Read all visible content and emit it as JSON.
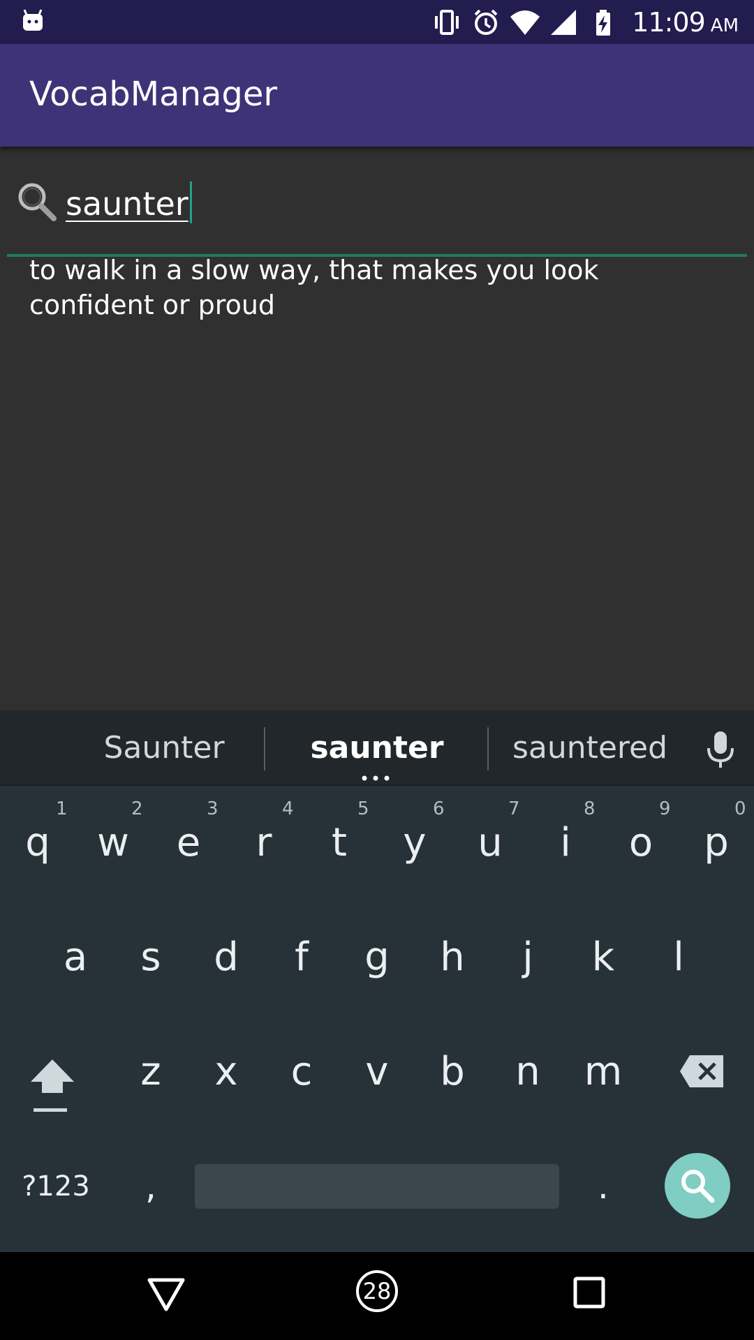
{
  "status_bar": {
    "time": "11:09",
    "ampm": "AM",
    "icons": [
      "android-icon",
      "vibrate-icon",
      "alarm-icon",
      "wifi-icon",
      "signal-icon",
      "battery-charging-icon"
    ]
  },
  "app_bar": {
    "title": "VocabManager"
  },
  "search": {
    "value": "saunter",
    "icon": "search-icon"
  },
  "definition": {
    "text": "to walk in a slow way, that makes you look confident or proud"
  },
  "keyboard": {
    "suggestions": [
      "Saunter",
      "saunter",
      "sauntered"
    ],
    "row1": [
      {
        "key": "q",
        "hint": "1"
      },
      {
        "key": "w",
        "hint": "2"
      },
      {
        "key": "e",
        "hint": "3"
      },
      {
        "key": "r",
        "hint": "4"
      },
      {
        "key": "t",
        "hint": "5"
      },
      {
        "key": "y",
        "hint": "6"
      },
      {
        "key": "u",
        "hint": "7"
      },
      {
        "key": "i",
        "hint": "8"
      },
      {
        "key": "o",
        "hint": "9"
      },
      {
        "key": "p",
        "hint": "0"
      }
    ],
    "row2": [
      "a",
      "s",
      "d",
      "f",
      "g",
      "h",
      "j",
      "k",
      "l"
    ],
    "row3": [
      "z",
      "x",
      "c",
      "v",
      "b",
      "n",
      "m"
    ],
    "symbols_label": "?123",
    "comma": ",",
    "period": ".",
    "colors": {
      "background": "#263238",
      "suggestion_bar": "#21272b",
      "search_key": "#7fcdc3"
    }
  },
  "nav_bar": {
    "badge_number": "28",
    "icons": [
      "back-icon",
      "home-icon",
      "recents-icon"
    ]
  },
  "colors": {
    "status_bar": "#231c4f",
    "app_bar": "#3f3378",
    "content_background": "#303030",
    "accent": "#22a38a"
  }
}
